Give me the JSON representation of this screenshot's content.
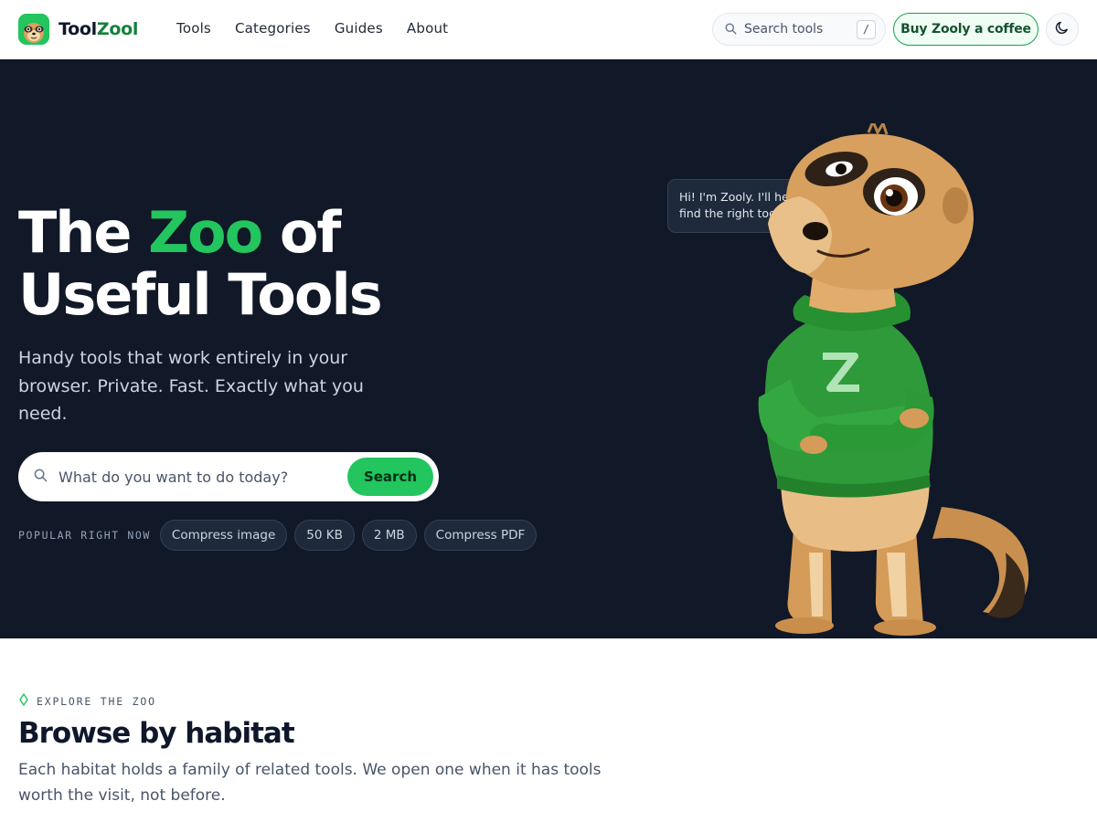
{
  "header": {
    "brand_part1": "Tool",
    "brand_part2": "Zool",
    "nav": [
      "Tools",
      "Categories",
      "Guides",
      "About"
    ],
    "search_placeholder": "Search tools",
    "search_shortcut": "/",
    "coffee_label": "Buy Zooly a coffee",
    "icons": {
      "logo": "meerkat-logo-icon",
      "search": "search-icon",
      "theme": "moon-icon"
    }
  },
  "hero": {
    "title_the": "The",
    "title_zoo": "Zoo",
    "title_of": "of",
    "title_line2": "Useful Tools",
    "subtitle": "Handy tools that work entirely in your browser. Private. Fast. Exactly what you need.",
    "search_placeholder": "What do you want to do today?",
    "search_button": "Search",
    "popular_label": "POPULAR RIGHT NOW",
    "popular_chips": [
      "Compress image",
      "50 KB",
      "2 MB",
      "Compress PDF"
    ],
    "bubble_text": "Hi! I'm Zooly. I'll help you find the right tool for the job."
  },
  "explore": {
    "eyebrow": "EXPLORE THE ZOO",
    "title": "Browse by habitat",
    "description": "Each habitat holds a family of related tools. We open one when it has tools worth the visit, not before."
  },
  "colors": {
    "accent_green": "#22c55e",
    "hero_background": "#111827",
    "brand_dark_green": "#15803d"
  }
}
